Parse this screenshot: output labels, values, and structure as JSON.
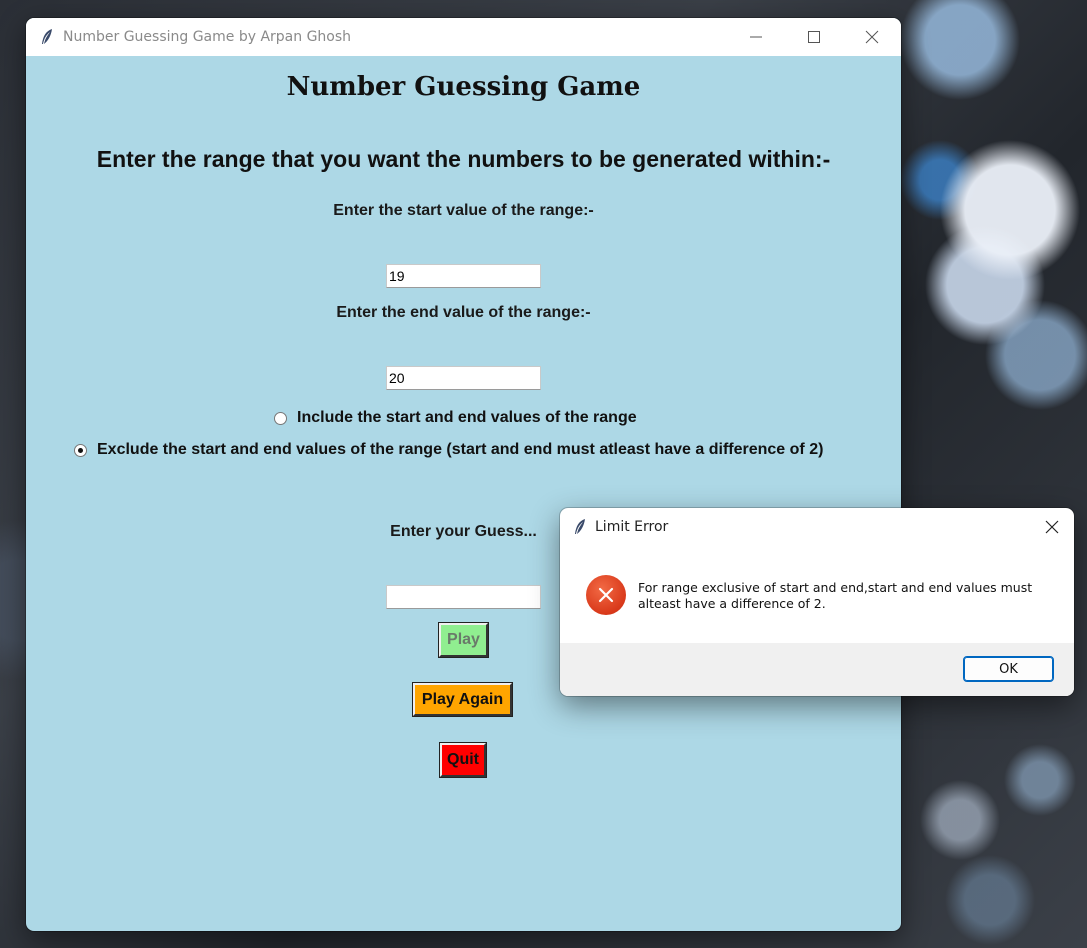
{
  "main_window": {
    "title": "Number Guessing Game by Arpan Ghosh",
    "controls": [
      "minimize",
      "maximize",
      "close"
    ]
  },
  "game": {
    "heading": "Number Guessing Game",
    "range_prompt": "Enter the range that you want the numbers to be generated within:-",
    "start_label": "Enter the start value of the range:-",
    "start_value": "19",
    "end_label": "Enter the end value of the range:-",
    "end_value": "20",
    "radio_include": "Include the start and end values of the range",
    "radio_exclude": "Exclude the start and end values of the range (start and end must atleast have a difference of 2)",
    "selected_option": "exclude",
    "guess_label": "Enter your Guess...",
    "guess_value": "",
    "play_label": "Play",
    "play_again_label": "Play Again",
    "quit_label": "Quit"
  },
  "dialog": {
    "title": "Limit Error",
    "message": "For range exclusive of start and end,start and end values must alteast have a difference of 2.",
    "ok_label": "OK",
    "icon": "error-icon"
  },
  "colors": {
    "window_bg": "#add8e6",
    "play_bg": "#90ee90",
    "play_again_bg": "#ffa500",
    "quit_bg": "#ff0000",
    "error_icon": "#d9391a",
    "ok_border": "#0067c0"
  }
}
